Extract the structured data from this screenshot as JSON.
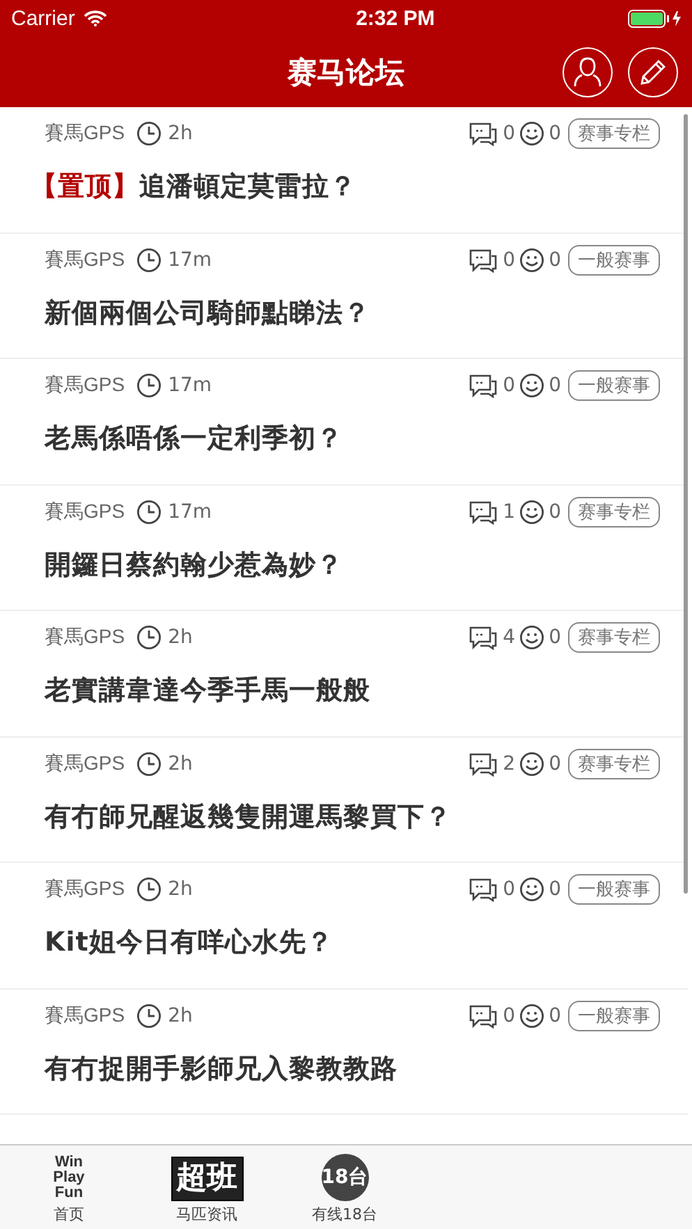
{
  "status_bar": {
    "carrier": "Carrier",
    "time": "2:32 PM"
  },
  "header": {
    "title": "赛马论坛"
  },
  "posts": [
    {
      "author": "賽馬GPS",
      "time": "2h",
      "comments": "0",
      "likes": "0",
      "tag": "赛事专栏",
      "pinned_label": "【置顶】",
      "title": "追潘頓定莫雷拉？"
    },
    {
      "author": "賽馬GPS",
      "time": "17m",
      "comments": "0",
      "likes": "0",
      "tag": "一般赛事",
      "title": "新個兩個公司騎師點睇法？"
    },
    {
      "author": "賽馬GPS",
      "time": "17m",
      "comments": "0",
      "likes": "0",
      "tag": "一般赛事",
      "title": "老馬係唔係一定利季初？"
    },
    {
      "author": "賽馬GPS",
      "time": "17m",
      "comments": "1",
      "likes": "0",
      "tag": "赛事专栏",
      "title": "開鑼日蔡約翰少惹為妙？"
    },
    {
      "author": "賽馬GPS",
      "time": "2h",
      "comments": "4",
      "likes": "0",
      "tag": "赛事专栏",
      "title": "老實講韋達今季手馬一般般"
    },
    {
      "author": "賽馬GPS",
      "time": "2h",
      "comments": "2",
      "likes": "0",
      "tag": "赛事专栏",
      "title": "有冇師兄醒返幾隻開運馬黎買下？"
    },
    {
      "author": "賽馬GPS",
      "time": "2h",
      "comments": "0",
      "likes": "0",
      "tag": "一般赛事",
      "title": "Kit姐今日有咩心水先？"
    },
    {
      "author": "賽馬GPS",
      "time": "2h",
      "comments": "0",
      "likes": "0",
      "tag": "一般赛事",
      "title": "有冇捉開手影師兄入黎教教路"
    }
  ],
  "tab_bar": [
    {
      "kind": "winplay",
      "label": "首页",
      "logo_text": [
        "Win",
        "Play",
        "Fun"
      ],
      "selected": false
    },
    {
      "kind": "chaoban",
      "label": "马匹资讯",
      "logo_text": [
        "超班"
      ],
      "selected": false
    },
    {
      "kind": "channel",
      "label": "有线18台",
      "logo_text": [
        "18台"
      ],
      "selected": false
    }
  ]
}
